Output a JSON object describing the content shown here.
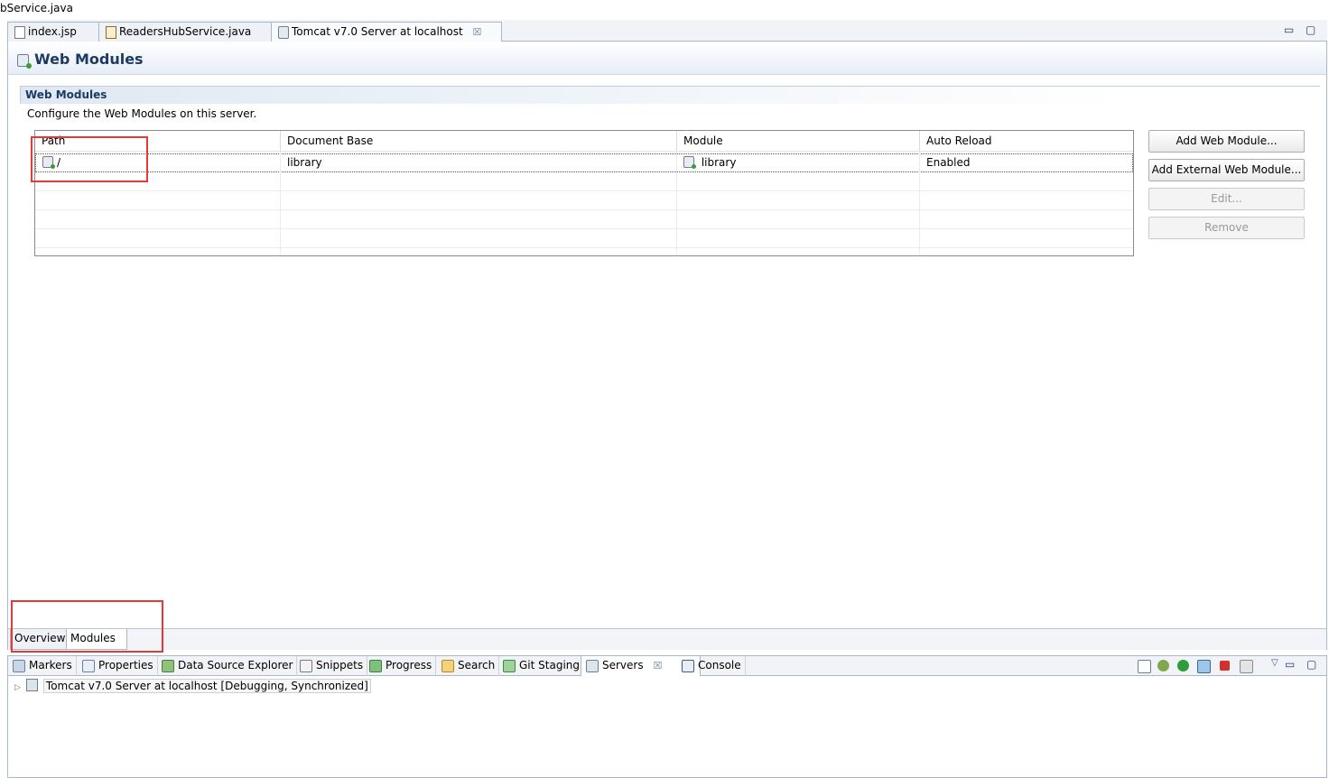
{
  "top_file": "bService.java",
  "editor_tabs": [
    {
      "label": "index.jsp"
    },
    {
      "label": "ReadersHubService.java"
    },
    {
      "label": "Tomcat v7.0 Server at localhost",
      "active": true
    }
  ],
  "window_controls": {
    "minimize": "▭",
    "maximize": "▢",
    "close_tab": "☒"
  },
  "header": {
    "title": "Web Modules"
  },
  "section": {
    "title": "Web Modules",
    "description": "Configure the Web Modules on this server."
  },
  "table": {
    "columns": [
      "Path",
      "Document Base",
      "Module",
      "Auto Reload"
    ],
    "rows": [
      {
        "path": "/",
        "document_base": "library",
        "module": "library",
        "auto_reload": "Enabled"
      }
    ]
  },
  "buttons": {
    "add_web_module": "Add Web Module...",
    "add_external_web_module": "Add External Web Module...",
    "edit": "Edit...",
    "remove": "Remove"
  },
  "page_tabs": [
    {
      "label": "Overview"
    },
    {
      "label": "Modules",
      "active": true
    }
  ],
  "views_tabs": [
    {
      "label": "Markers",
      "icon": "markers-icon"
    },
    {
      "label": "Properties",
      "icon": "properties-icon"
    },
    {
      "label": "Data Source Explorer",
      "icon": "data-source-icon"
    },
    {
      "label": "Snippets",
      "icon": "snippets-icon"
    },
    {
      "label": "Progress",
      "icon": "progress-icon"
    },
    {
      "label": "Search",
      "icon": "search-icon"
    },
    {
      "label": "Git Staging",
      "icon": "git-staging-icon"
    },
    {
      "label": "Servers",
      "icon": "servers-icon",
      "active": true
    },
    {
      "label": "Console",
      "icon": "console-icon"
    }
  ],
  "servers": {
    "entry": "Tomcat v7.0 Server at localhost  [Debugging, Synchronized]"
  },
  "colors": {
    "title_blue": "#1c3b62",
    "annotation_red": "#e53935",
    "stop_red": "#d32f2f",
    "run_green": "#2e9e3a"
  }
}
